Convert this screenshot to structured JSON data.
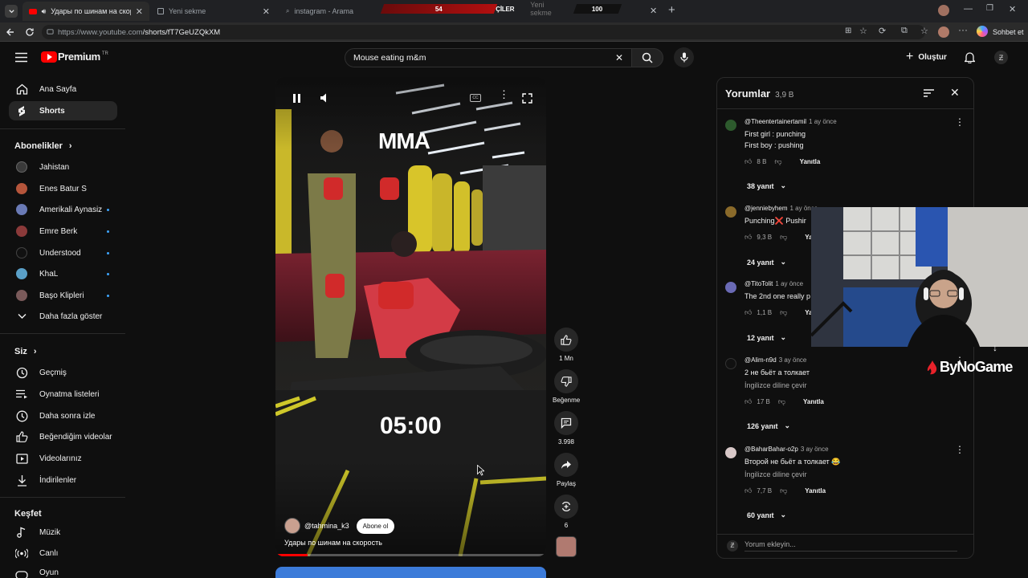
{
  "browser": {
    "tabs": [
      {
        "title": "Удары по шинам на скорость"
      },
      {
        "title": "Yeni sekme"
      },
      {
        "title": "instagram - Arama"
      },
      {
        "title": "Yeni sekme"
      }
    ],
    "overlay_left_number": "54",
    "overlay_title": "TAKİPÇİLER",
    "overlay_right_number": "100",
    "url_host": "https://www.youtube.com",
    "url_path": "/shorts/fT7GeUZQkXM",
    "chat_label": "Sohbet et"
  },
  "header": {
    "logo_text": "Premium",
    "logo_region": "TR",
    "search_value": "Mouse eating m&m",
    "create_label": "Oluştur"
  },
  "sidebar": {
    "main": [
      {
        "label": "Ana Sayfa",
        "icon": "home-icon"
      },
      {
        "label": "Shorts",
        "icon": "shorts-icon"
      }
    ],
    "subscriptions_title": "Abonelikler",
    "subscriptions": [
      {
        "label": "Jahistan",
        "color": "#3a3a3a",
        "dot": false
      },
      {
        "label": "Enes Batur S",
        "color": "#b5553b",
        "dot": false
      },
      {
        "label": "Amerikali Aynasiz",
        "color": "#6a7ab5",
        "dot": true
      },
      {
        "label": "Emre Berk",
        "color": "#8b3a3a",
        "dot": true
      },
      {
        "label": "Understood",
        "color": "#111111",
        "dot": true
      },
      {
        "label": "KhaL",
        "color": "#5aa0c8",
        "dot": true
      },
      {
        "label": "Başo Klipleri",
        "color": "#7a5a5a",
        "dot": true
      }
    ],
    "show_more": "Daha fazla göster",
    "you_title": "Siz",
    "you": [
      {
        "label": "Geçmiş",
        "icon": "history-icon"
      },
      {
        "label": "Oynatma listeleri",
        "icon": "playlist-icon"
      },
      {
        "label": "Daha sonra izle",
        "icon": "clock-icon"
      },
      {
        "label": "Beğendiğim videolar",
        "icon": "thumb-up-icon"
      },
      {
        "label": "Videolarınız",
        "icon": "video-icon"
      },
      {
        "label": "İndirilenler",
        "icon": "download-icon"
      }
    ],
    "explore_title": "Keşfet",
    "explore": [
      {
        "label": "Müzik",
        "icon": "music-icon"
      },
      {
        "label": "Canlı",
        "icon": "live-icon"
      },
      {
        "label": "Oyun",
        "icon": "game-icon"
      }
    ]
  },
  "video": {
    "overlay_text": "MMA",
    "timer": "05:00",
    "channel": "@tahmina_k3",
    "subscribe_label": "Abone ol",
    "title": "Удары по шинам на скорость",
    "progress": 0.12
  },
  "actions": {
    "likes": "1 Mn",
    "dislike_label": "Beğenme",
    "comments": "3.998",
    "share_label": "Paylaş",
    "remix": "6"
  },
  "comments": {
    "title": "Yorumlar",
    "count": "3,9 B",
    "input_placeholder": "Yorum ekleyin...",
    "items": [
      {
        "author": "@Theentertainertamil",
        "time": "1 ay önce",
        "lines": [
          "First girl : punching",
          "First boy : pushing"
        ],
        "translate": "",
        "likes": "8 B",
        "reply": "Yanıtla",
        "replies": "38 yanıt",
        "avatar_color": "#2d5a2d"
      },
      {
        "author": "@jenniebyhem",
        "time": "1 ay önce",
        "lines": [
          "Punching❌ Pushir"
        ],
        "translate": "",
        "likes": "9,3 B",
        "reply": "Ya",
        "replies": "24 yanıt",
        "avatar_color": "#8a6a2a"
      },
      {
        "author": "@TitoTolit",
        "time": "1 ay önce",
        "lines": [
          "The 2nd one really p"
        ],
        "translate": "",
        "likes": "1,1 B",
        "reply": "Ya",
        "replies": "12 yanıt",
        "avatar_color": "#6a6ab5"
      },
      {
        "author": "@Alim-n9d",
        "time": "3 ay önce",
        "lines": [
          "2 не бьёт а толкает"
        ],
        "translate": "İngilizce diline çevir",
        "likes": "17 B",
        "reply": "Yanıtla",
        "replies": "126 yanıt",
        "avatar_color": "#111111"
      },
      {
        "author": "@BaharBahar-o2p",
        "time": "3 ay önce",
        "lines": [
          "Второй не бьёт а толкает 😂"
        ],
        "translate": "İngilizce diline çevir",
        "likes": "7,7 B",
        "reply": "Yanıtla",
        "replies": "60 yanıt",
        "avatar_color": "#d8c8c8"
      }
    ]
  },
  "webcam": {
    "brand": "ByNoGame"
  }
}
